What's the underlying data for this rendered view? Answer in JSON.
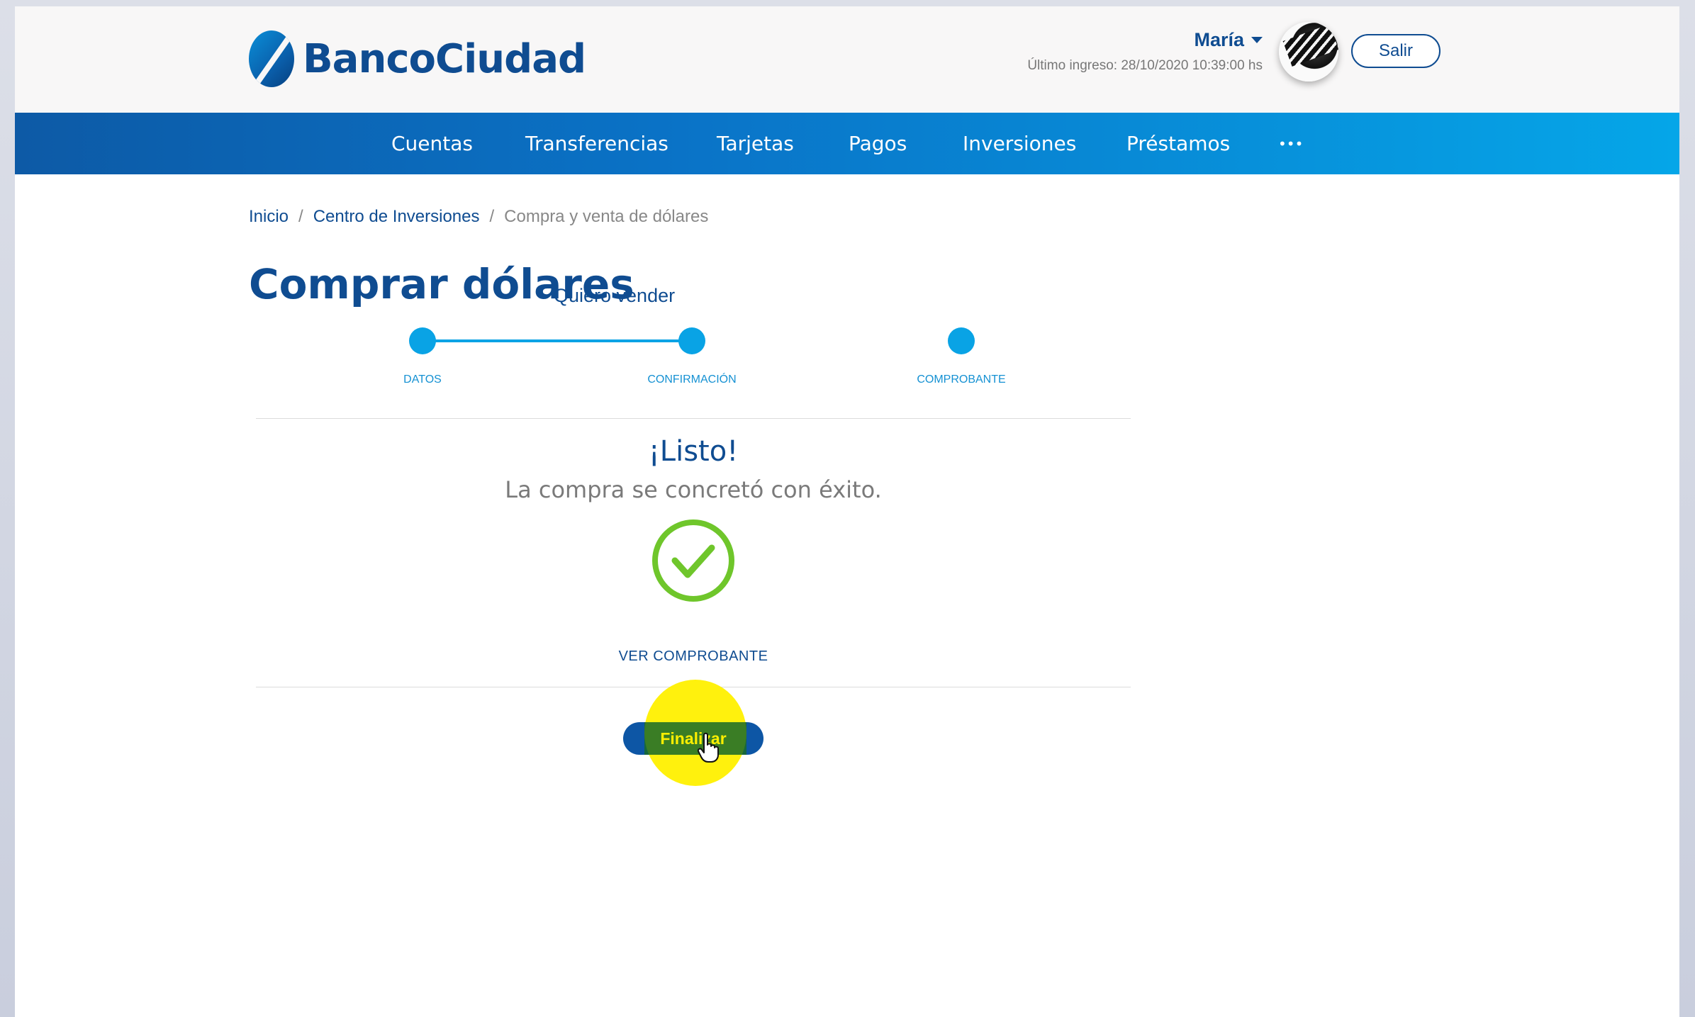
{
  "header": {
    "logo_text": "BancoCiudad",
    "user_name": "María",
    "last_login": "Último ingreso: 28/10/2020 10:39:00 hs",
    "logout_label": "Salir"
  },
  "nav": {
    "items": [
      {
        "label": "Cuentas"
      },
      {
        "label": "Transferencias"
      },
      {
        "label": "Tarjetas"
      },
      {
        "label": "Pagos"
      },
      {
        "label": "Inversiones"
      },
      {
        "label": "Préstamos"
      },
      {
        "label": "•••"
      }
    ]
  },
  "breadcrumb": {
    "items": [
      {
        "label": "Inicio"
      },
      {
        "label": "Centro de Inversiones"
      },
      {
        "label": "Compra y venta de dólares"
      }
    ],
    "separator": "/"
  },
  "page": {
    "title": "Comprar dólares",
    "switch_link": "Quiero vender"
  },
  "stepper": {
    "steps": [
      {
        "label": "DATOS"
      },
      {
        "label": "CONFIRMACIÓN"
      },
      {
        "label": "COMPROBANTE"
      }
    ],
    "accent_color": "#09a3e5"
  },
  "result": {
    "title": "¡Listo!",
    "message": "La compra se concretó con éxito.",
    "icon": "check-circle-icon",
    "icon_color": "#6fc62b",
    "view_receipt_label": "VER COMPROBANTE"
  },
  "actions": {
    "finish_label": "Finalizar"
  },
  "colors": {
    "brand": "#0f4c91",
    "click_highlight": "#fff000"
  }
}
